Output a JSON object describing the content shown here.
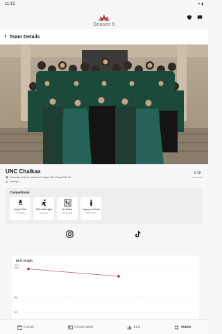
{
  "status_bar": {
    "time": "11:12"
  },
  "header": {
    "season_title": "Season 9"
  },
  "nav": {
    "title": "Team Details"
  },
  "team": {
    "name": "UNC Chalkaa",
    "university": "University of North Carolina at Chapel Hill • Chapel Hill, NC",
    "style": "Dandiya",
    "rank": "# 19",
    "rank_sub": "Oct 1 2027"
  },
  "competitions": {
    "heading": "Competitions",
    "items": [
      {
        "name": "Aag Ki Taal",
        "date": "Feb 2025",
        "icon": "dancer-logo"
      },
      {
        "name": "GGA Indie Night",
        "date": "Feb 2025",
        "icon": "dancer-logo"
      },
      {
        "name": "NJ Naach",
        "date": "Feb 22 2025",
        "icon": "n-logo"
      },
      {
        "name": "Legacy on Broad",
        "date": "Mar 8 2025",
        "icon": "figure-logo"
      }
    ]
  },
  "social": {
    "instagram": "instagram-icon",
    "tiktok": "tiktok-icon"
  },
  "chart_data": {
    "type": "line",
    "title": "ELO Graph",
    "ylim": [
      890,
      1060
    ],
    "yticks": [
      1070,
      1050,
      950,
      900
    ],
    "series": [
      {
        "values": [
          1047,
          1022
        ]
      }
    ],
    "grid": true
  },
  "bottom_nav": {
    "tabs": [
      {
        "label": "Comps",
        "icon": "calendar-icon"
      },
      {
        "label": "Circuit News",
        "icon": "news-icon"
      },
      {
        "label": "ELO",
        "icon": "bar-chart-icon"
      },
      {
        "label": "Teams",
        "icon": "people-icon"
      }
    ],
    "active": "Teams"
  },
  "colors": {
    "accent": "#b3263a",
    "chart_line": "#b8596b",
    "chart_point": "#7a1525"
  }
}
